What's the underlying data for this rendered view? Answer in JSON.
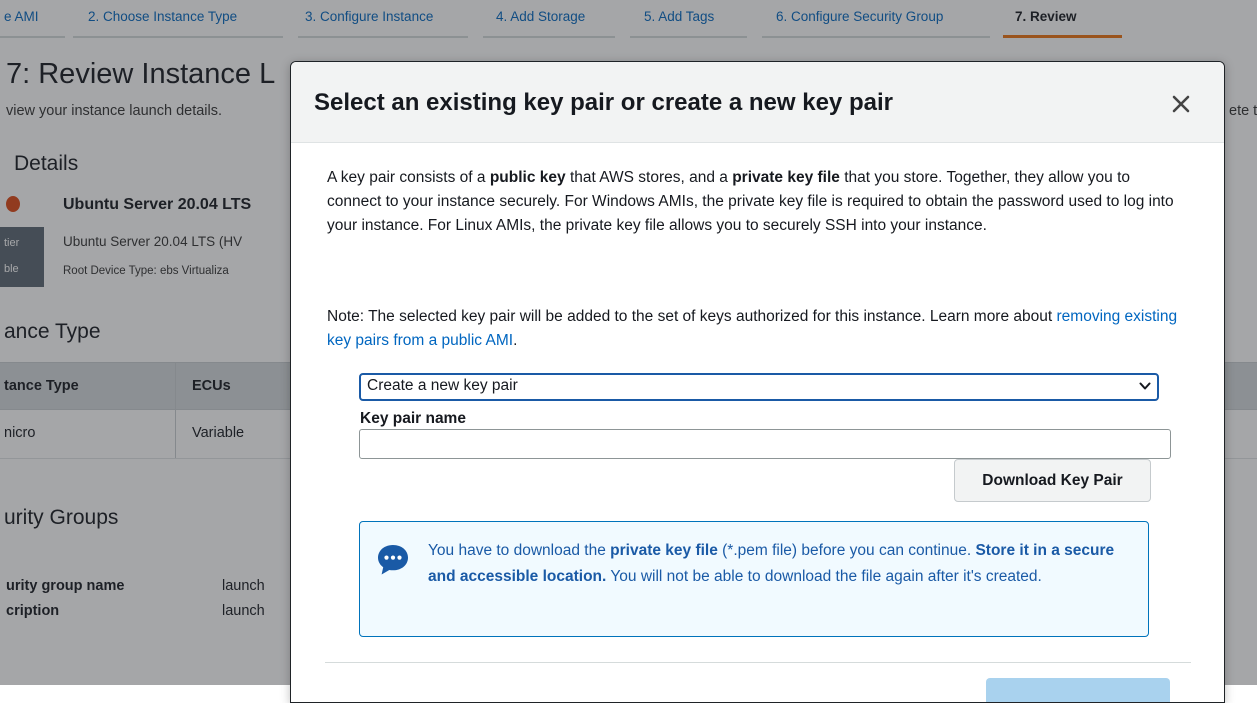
{
  "wizard_steps": [
    {
      "label": "e AMI"
    },
    {
      "label": "2. Choose Instance Type"
    },
    {
      "label": "3. Configure Instance"
    },
    {
      "label": "4. Add Storage"
    },
    {
      "label": "5. Add Tags"
    },
    {
      "label": "6. Configure Security Group"
    },
    {
      "label": "7. Review"
    }
  ],
  "page": {
    "title": "7: Review Instance L",
    "subtitle": "view your instance launch details.",
    "subtitle_right": "ete t",
    "details_heading": "Details",
    "ami_name": "Ubuntu Server 20.04 LTS",
    "ami_desc": "Ubuntu Server 20.04 LTS (HV",
    "ami_meta": "Root Device Type: ebs    Virtualiza",
    "free_tier_line1": "tier",
    "free_tier_line2": "ble",
    "instance_type_heading": "ance Type",
    "table": {
      "headers": [
        "tance Type",
        "ECUs"
      ],
      "rows": [
        [
          "nicro",
          "Variable"
        ]
      ]
    },
    "security_groups_heading": "urity Groups",
    "sg_rows": [
      {
        "label": "urity group name",
        "value": "launch"
      },
      {
        "label": "cription",
        "value": "launch"
      }
    ]
  },
  "modal": {
    "title": "Select an existing key pair or create a new key pair",
    "close_icon": "close-icon",
    "intro": {
      "part1": "A key pair consists of a ",
      "bold1": "public key",
      "part2": " that AWS stores, and a ",
      "bold2": "private key file",
      "part3": " that you store. Together, they allow you to connect to your instance securely. For Windows AMIs, the private key file is required to obtain the password used to log into your instance. For Linux AMIs, the private key file allows you to securely SSH into your instance."
    },
    "note": {
      "text": "Note: The selected key pair will be added to the set of keys authorized for this instance. Learn more about ",
      "link": "removing existing key pairs from a public AMI",
      "end": "."
    },
    "select_value": "Create a new key pair",
    "key_pair_label": "Key pair name",
    "key_pair_value": "",
    "download_button": "Download Key Pair",
    "info": {
      "icon": "speech-bubble-icon",
      "part1": "You have to download the ",
      "bold1": "private key file",
      "part2": " (*.pem file) before you can continue. ",
      "bold2": "Store it in a secure and accessible location.",
      "part3": " You will not be able to download the file again after it's created."
    }
  },
  "colors": {
    "accent": "#ec7211",
    "link": "#0066c0",
    "info_bg": "#f1faff",
    "info_border": "#0073bb"
  }
}
